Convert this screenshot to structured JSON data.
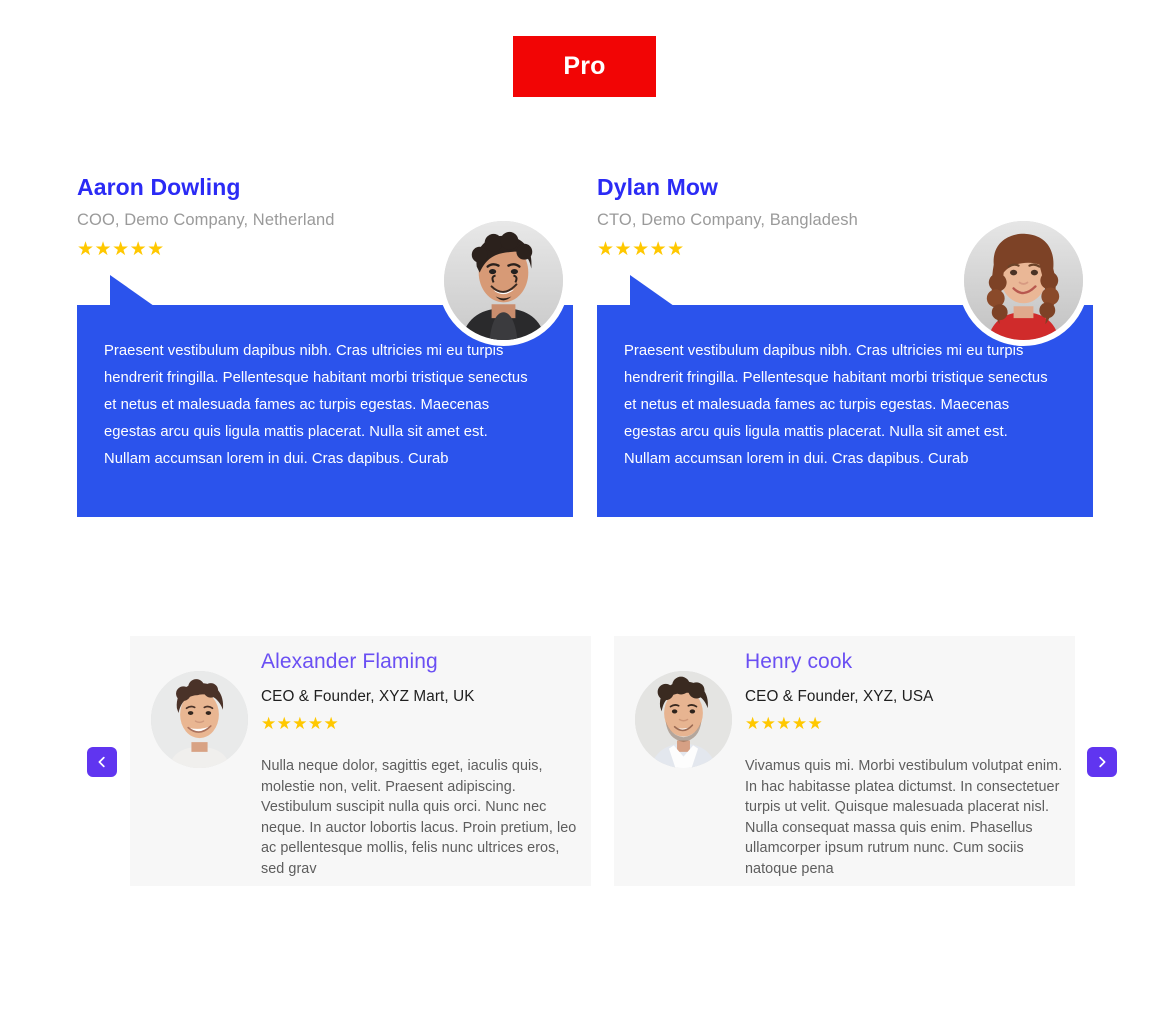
{
  "badge": {
    "label": "Pro",
    "color": "#f20505"
  },
  "colors": {
    "bubble_bg": "#2b53ec",
    "bubble_name": "#2b2bf5",
    "flat_card_bg": "#f7f7f7",
    "flat_name": "#6a4ff3",
    "star": "#ffc800",
    "nav_button": "#6035f0"
  },
  "star_glyph": "★",
  "bubble_testimonials": [
    {
      "name": "Aaron Dowling",
      "role": "COO, Demo Company, Netherland",
      "rating": 5,
      "stars": "★★★★★",
      "quote": "Praesent vestibulum dapibus nibh. Cras ultricies mi eu turpis hendrerit fringilla. Pellentesque habitant morbi tristique senectus et netus et malesuada fames ac turpis egestas. Maecenas egestas arcu quis ligula mattis placerat. Nulla sit amet est. Nullam accumsan lorem in dui. Cras dapibus. Curab",
      "avatar": "avatar-man-curly-dark-suit"
    },
    {
      "name": "Dylan Mow",
      "role": "CTO, Demo Company, Bangladesh",
      "rating": 5,
      "stars": "★★★★★",
      "quote": "Praesent vestibulum dapibus nibh. Cras ultricies mi eu turpis hendrerit fringilla. Pellentesque habitant morbi tristique senectus et netus et malesuada fames ac turpis egestas. Maecenas egestas arcu quis ligula mattis placerat. Nulla sit amet est. Nullam accumsan lorem in dui. Cras dapibus. Curab",
      "avatar": "avatar-woman-wavy-auburn-red-top"
    }
  ],
  "carousel_testimonials": [
    {
      "name": "Alexander Flaming",
      "role": "CEO & Founder, XYZ Mart, UK",
      "rating": 5,
      "stars": "★★★★★",
      "quote": "Nulla neque dolor, sagittis eget, iaculis quis, molestie non, velit. Praesent adipiscing. Vestibulum suscipit nulla quis orci. Nunc nec neque. In auctor lobortis lacus. Proin pretium, leo ac pellentesque mollis, felis nunc ultrices eros, sed grav",
      "avatar": "avatar-man-smiling-brown-hair"
    },
    {
      "name": "Henry cook",
      "role": "CEO & Founder, XYZ, USA",
      "rating": 5,
      "stars": "★★★★★",
      "quote": "Vivamus quis mi. Morbi vestibulum volutpat enim. In hac habitasse platea dictumst. In consectetuer turpis ut velit. Quisque malesuada placerat nisl. Nulla consequat massa quis enim. Phasellus ullamcorper ipsum rutrum nunc. Cum sociis natoque pena",
      "avatar": "avatar-man-stubble-white-shirt"
    }
  ],
  "nav": {
    "prev_icon": "chevron-left-icon",
    "next_icon": "chevron-right-icon"
  }
}
